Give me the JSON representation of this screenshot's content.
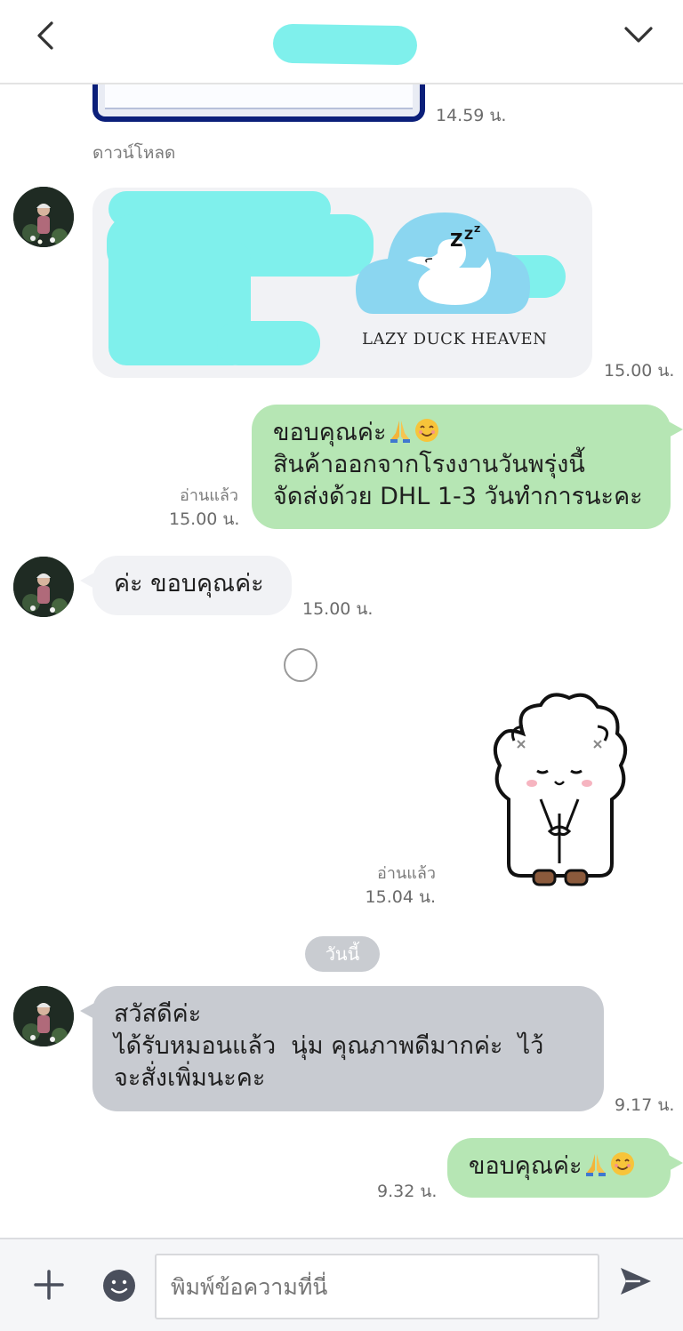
{
  "header": {
    "back_icon": "chevron-left-icon",
    "menu_icon": "chevron-down-icon"
  },
  "messages": {
    "file_time": "14.59 น.",
    "download_label": "ดาวน์โหลด",
    "image_time": "15.00 น.",
    "image_caption": "LAZY DUCK HEAVEN",
    "out1_lines": [
      "ขอบคุณค่ะ",
      "สินค้าออกจากโรงงานวันพรุ่งนี้",
      "จัดส่งด้วย DHL 1-3 วันทำการนะคะ"
    ],
    "out1_read": "อ่านแล้ว",
    "out1_time": "15.00 น.",
    "in2_text": "ค่ะ ขอบคุณค่ะ",
    "in2_time": "15.00 น.",
    "sticker_read": "อ่านแล้ว",
    "sticker_time": "15.04 น.",
    "date_label": "วันนี้",
    "in3_lines": [
      "สวัสดีค่ะ",
      "ได้รับหมอนแล้ว  นุ่ม คุณภาพดีมากค่ะ  ไว้",
      "จะสั่งเพิ่มนะคะ"
    ],
    "in3_time": "9.17 น.",
    "out2_text": "ขอบคุณค่ะ",
    "out2_time": "9.32 น."
  },
  "input": {
    "placeholder": "พิมพ์ข้อความที่นี่",
    "plus_icon": "plus-icon",
    "emoji_icon": "smiley-icon",
    "send_icon": "send-icon"
  },
  "colors": {
    "outgoing_bubble": "#b6e6b4",
    "incoming_bubble": "#f1f2f5",
    "incoming_dark_bubble": "#c8cbd1",
    "redaction": "#7ff0ec"
  }
}
